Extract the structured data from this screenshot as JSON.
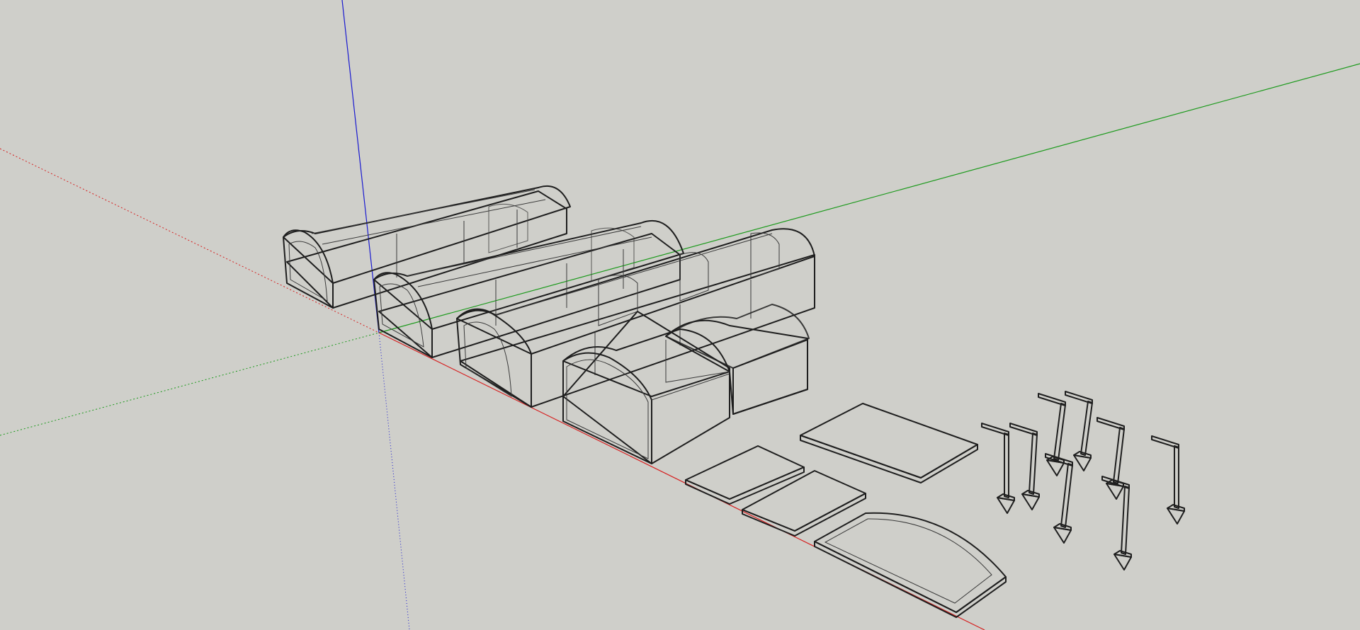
{
  "app": {
    "type": "3d-modeling-viewport",
    "background_color": "#cfcfca"
  },
  "axes": {
    "red_axis_color": "#d62020",
    "green_axis_color": "#1c9a1c",
    "blue_axis_color": "#1a1ad0"
  },
  "colors": {
    "edge": "#1e1e1e",
    "wall_gray": "#a9a9a9",
    "wall_light": "#bdbdbd",
    "roof_glass": "#8fa8b8",
    "blue_panel": "#7f9db1",
    "plate_dark": "#5e5e5e",
    "white_face": "#f2f2f2"
  },
  "scene_objects": [
    "long-cabin-module",
    "long-cabin-module",
    "medium-cabin-module",
    "short-cabin-module",
    "blue-cabin-module",
    "floor-plate",
    "floor-plate",
    "floor-plate",
    "arched-end-plate",
    "post-footing"
  ]
}
